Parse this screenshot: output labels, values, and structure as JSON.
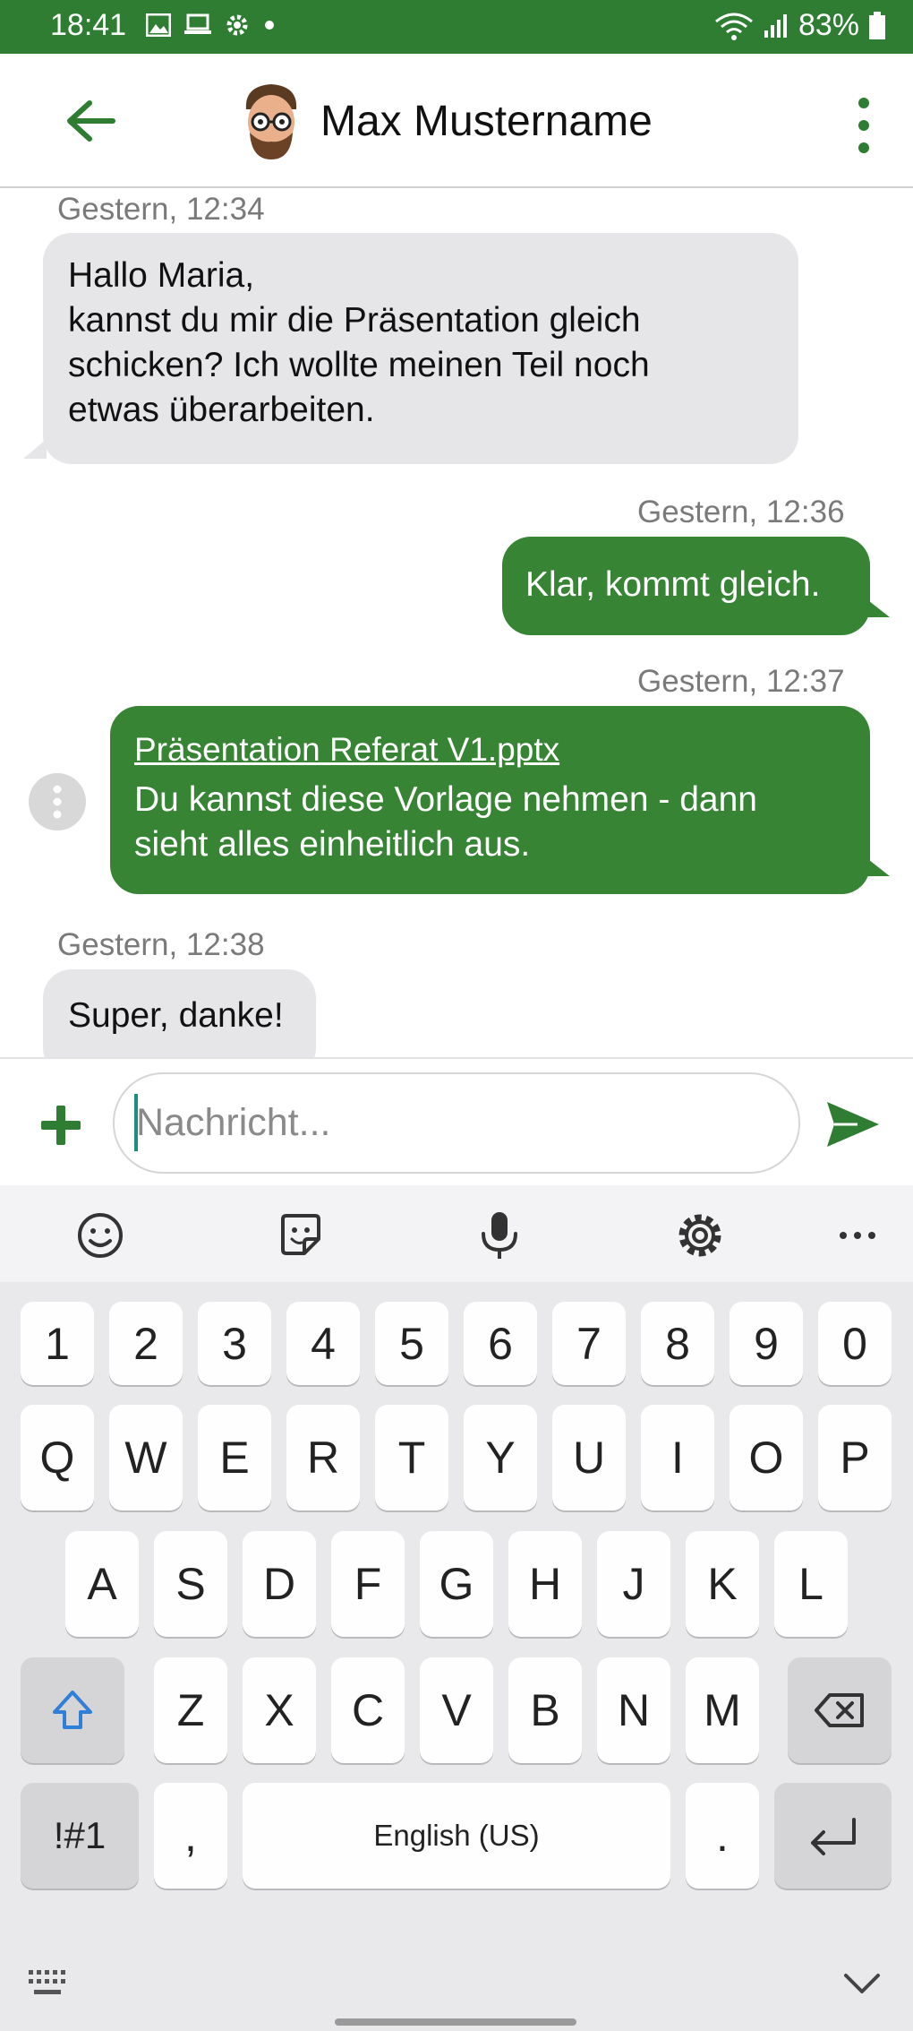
{
  "status": {
    "time": "18:41",
    "battery": "83%"
  },
  "header": {
    "name": "Max Mustername"
  },
  "messages": [
    {
      "timestamp": "Gestern, 12:34",
      "lines": [
        "Hallo Maria,",
        "kannst du mir die Präsentation gleich",
        "schicken? Ich wollte meinen Teil noch",
        "etwas überarbeiten."
      ]
    },
    {
      "timestamp": "Gestern, 12:36",
      "text": "Klar, kommt gleich."
    },
    {
      "timestamp": "Gestern, 12:37",
      "attachment": "Präsentation Referat V1.pptx",
      "lines": [
        "Du kannst diese Vorlage nehmen - dann",
        "sieht alles einheitlich aus."
      ]
    },
    {
      "timestamp": "Gestern, 12:38",
      "text": "Super, danke!"
    }
  ],
  "composer": {
    "placeholder": "Nachricht..."
  },
  "keyboard": {
    "numbers": [
      "1",
      "2",
      "3",
      "4",
      "5",
      "6",
      "7",
      "8",
      "9",
      "0"
    ],
    "row1": [
      "Q",
      "W",
      "E",
      "R",
      "T",
      "Y",
      "U",
      "I",
      "O",
      "P"
    ],
    "row2": [
      "A",
      "S",
      "D",
      "F",
      "G",
      "H",
      "J",
      "K",
      "L"
    ],
    "row3": [
      "Z",
      "X",
      "C",
      "V",
      "B",
      "N",
      "M"
    ],
    "symbols": "!#1",
    "comma": ",",
    "space": "English (US)",
    "period": "."
  },
  "colors": {
    "primary": "#2e7d32",
    "outgoing_bubble": "#378435",
    "incoming_bubble": "#e6e6e8"
  }
}
